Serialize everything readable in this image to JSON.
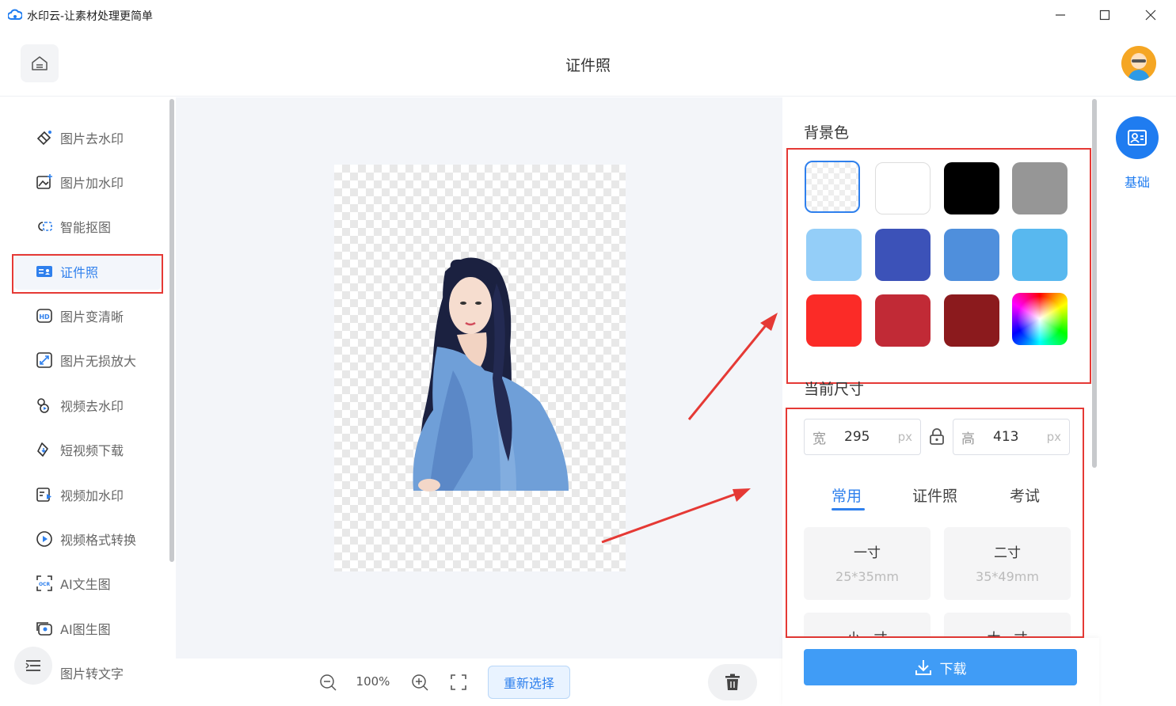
{
  "window": {
    "title": "水印云-让素材处理更简单",
    "controls": [
      "minimize-icon",
      "maximize-icon",
      "close-icon"
    ]
  },
  "header": {
    "title": "证件照",
    "home_icon": "home-icon"
  },
  "sidebar": {
    "items": [
      {
        "label": "图片去水印",
        "icon": "eraser-icon"
      },
      {
        "label": "图片加水印",
        "icon": "image-add-icon"
      },
      {
        "label": "智能抠图",
        "icon": "cutout-icon"
      },
      {
        "label": "证件照",
        "icon": "id-card-icon",
        "active": true
      },
      {
        "label": "图片变清晰",
        "icon": "hd-icon"
      },
      {
        "label": "图片无损放大",
        "icon": "enlarge-icon"
      },
      {
        "label": "视频去水印",
        "icon": "video-eraser-icon"
      },
      {
        "label": "短视频下载",
        "icon": "download-link-icon"
      },
      {
        "label": "视频加水印",
        "icon": "video-add-icon"
      },
      {
        "label": "视频格式转换",
        "icon": "video-convert-icon"
      },
      {
        "label": "AI文生图",
        "icon": "ocr-icon"
      },
      {
        "label": "AI图生图",
        "icon": "ai-image-icon"
      },
      {
        "label": "图片转文字",
        "icon": "text-icon"
      }
    ]
  },
  "canvas": {
    "zoom": "100%",
    "reselect_label": "重新选择"
  },
  "panel": {
    "bg_title": "背景色",
    "swatches": [
      "transparent",
      "#ffffff",
      "#000000",
      "#969696",
      "#94cef8",
      "#3c52b8",
      "#4f8fdc",
      "#58b8ef",
      "#fb2b27",
      "#c12a36",
      "#8b1a1d",
      "gradient"
    ],
    "size_title": "当前尺寸",
    "width": {
      "label": "宽",
      "value": "295",
      "unit": "px"
    },
    "height": {
      "label": "高",
      "value": "413",
      "unit": "px"
    },
    "tabs": [
      "常用",
      "证件照",
      "考试"
    ],
    "active_tab": 0,
    "sizes": [
      {
        "name": "一寸",
        "dim": "25*35mm"
      },
      {
        "name": "二寸",
        "dim": "35*49mm"
      },
      {
        "name": "小一寸",
        "dim": ""
      },
      {
        "name": "大一寸",
        "dim": ""
      }
    ],
    "download_label": "下载"
  },
  "right_rail": {
    "basic_label": "基础"
  },
  "colors": {
    "accent": "#2f80ed",
    "annotation": "#e53935"
  }
}
